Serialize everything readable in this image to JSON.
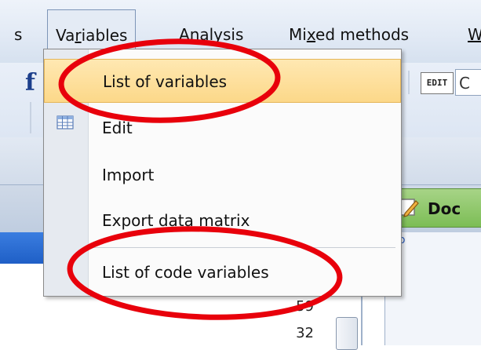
{
  "menubar": {
    "items": [
      {
        "label": "s"
      },
      {
        "label_pre": "Va",
        "label_ul": "r",
        "label_post": "iables"
      },
      {
        "label_pre": "",
        "label_ul": "A",
        "label_post": "nalysis"
      },
      {
        "label_pre": "Mi",
        "label_ul": "x",
        "label_post": "ed methods"
      },
      {
        "label_pre": "",
        "label_ul": "W",
        "label_post": ""
      }
    ]
  },
  "toolbar": {
    "f_label": "f",
    "edit_label": "EDIT",
    "input_value": "C"
  },
  "document_button": {
    "label": "Doc"
  },
  "dropdown": {
    "items": [
      {
        "label": "List of variables",
        "icon": ""
      },
      {
        "label": "Edit",
        "icon": "grid-icon"
      },
      {
        "label": "Import",
        "icon": ""
      },
      {
        "label": "Export data matrix",
        "icon": ""
      },
      {
        "label": "List of code variables",
        "icon": ""
      }
    ]
  },
  "content": {
    "numbers": [
      "59",
      "32"
    ],
    "small_text": "o"
  },
  "colors": {
    "highlight": "#fcd889",
    "annotation": "#e8000b",
    "accent_blue": "#1f5fc6",
    "doc_green": "#7cbd55"
  }
}
